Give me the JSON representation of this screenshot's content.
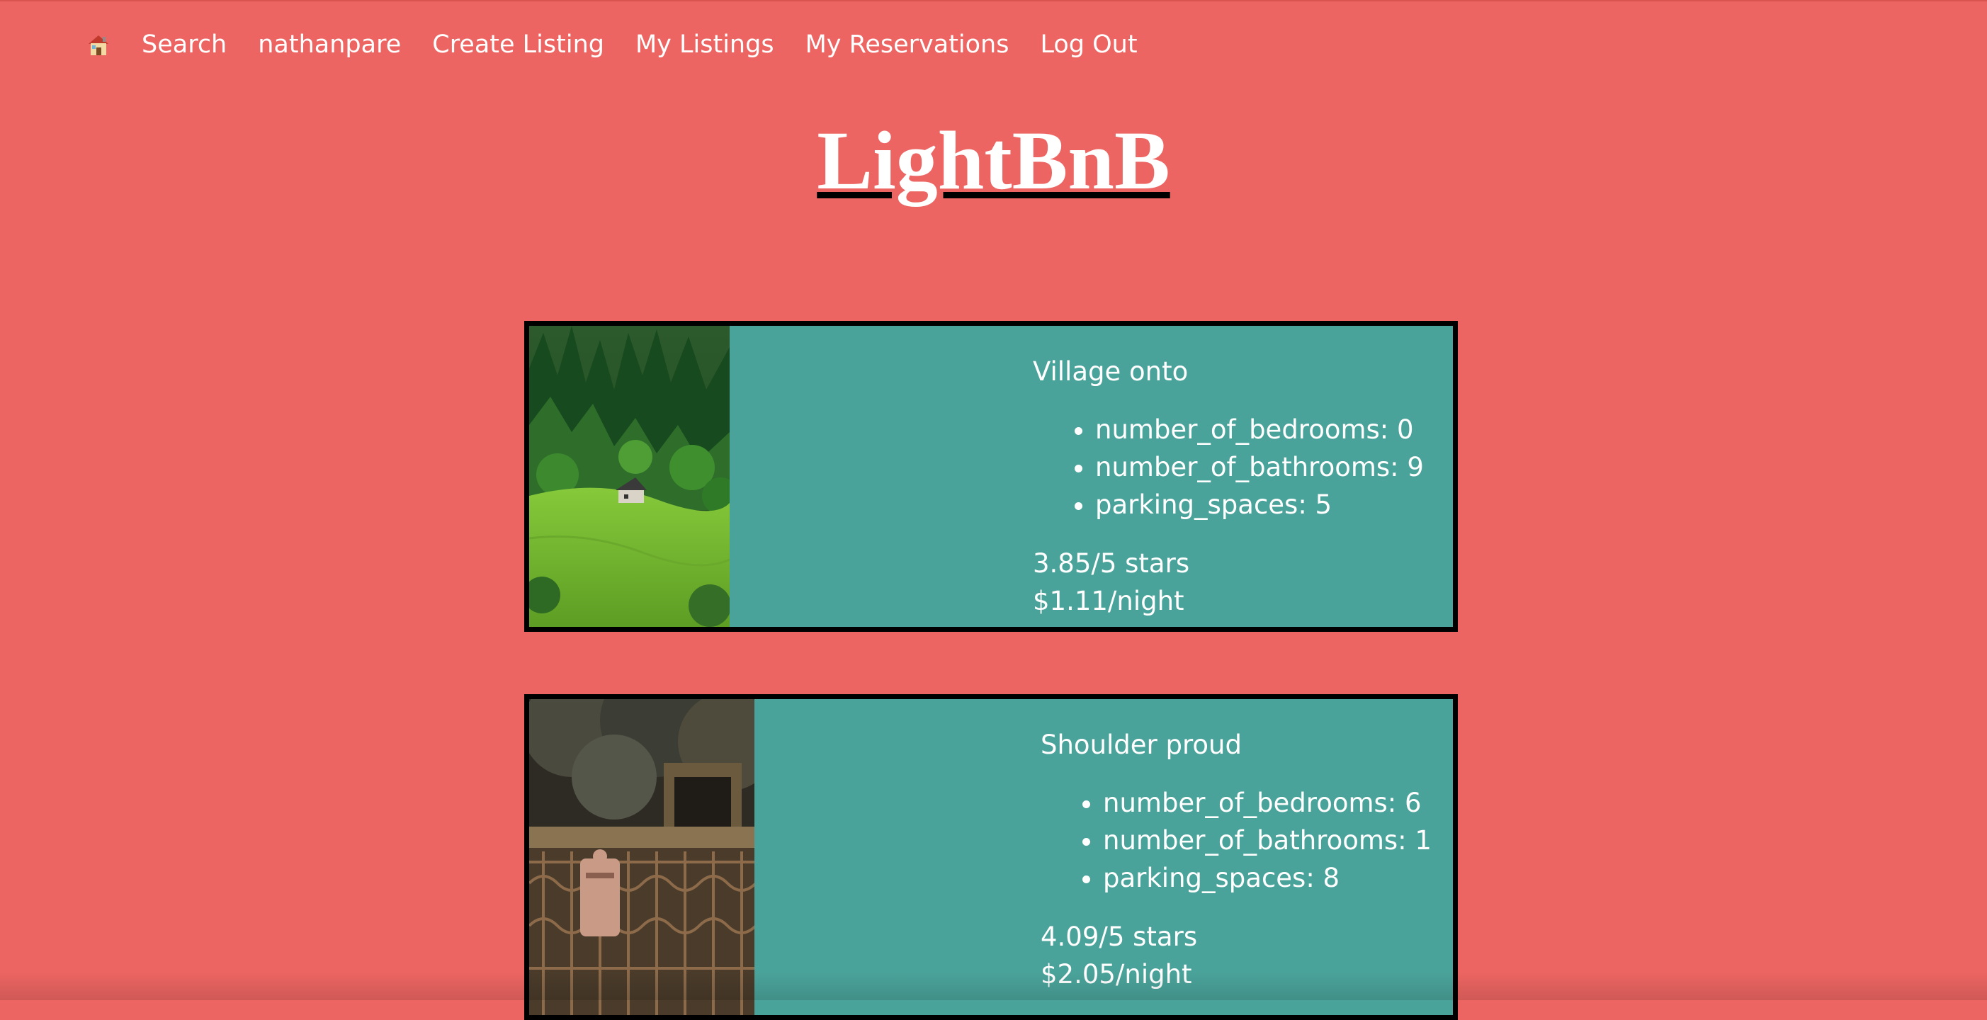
{
  "nav": {
    "home_icon": "house-icon",
    "items": [
      {
        "label": "Search"
      },
      {
        "label": "nathanpare"
      },
      {
        "label": "Create Listing"
      },
      {
        "label": "My Listings"
      },
      {
        "label": "My Reservations"
      },
      {
        "label": "Log Out"
      }
    ]
  },
  "page": {
    "title": "LightBnB"
  },
  "colors": {
    "background": "#ec6562",
    "card": "#4aa39a",
    "card_border": "#000000",
    "text": "#ffffff"
  },
  "listings": [
    {
      "title": "Village onto",
      "details": [
        "number_of_bedrooms: 0",
        "number_of_bathrooms: 9",
        "parking_spaces: 5"
      ],
      "rating": "3.85/5 stars",
      "price": "$1.11/night",
      "photo": "forest-hillside-cabin-photo"
    },
    {
      "title": "Shoulder proud",
      "details": [
        "number_of_bedrooms: 6",
        "number_of_bathrooms: 1",
        "parking_spaces: 8"
      ],
      "rating": "4.09/5 stars",
      "price": "$2.05/night",
      "photo": "iron-gate-mailbox-photo"
    }
  ]
}
